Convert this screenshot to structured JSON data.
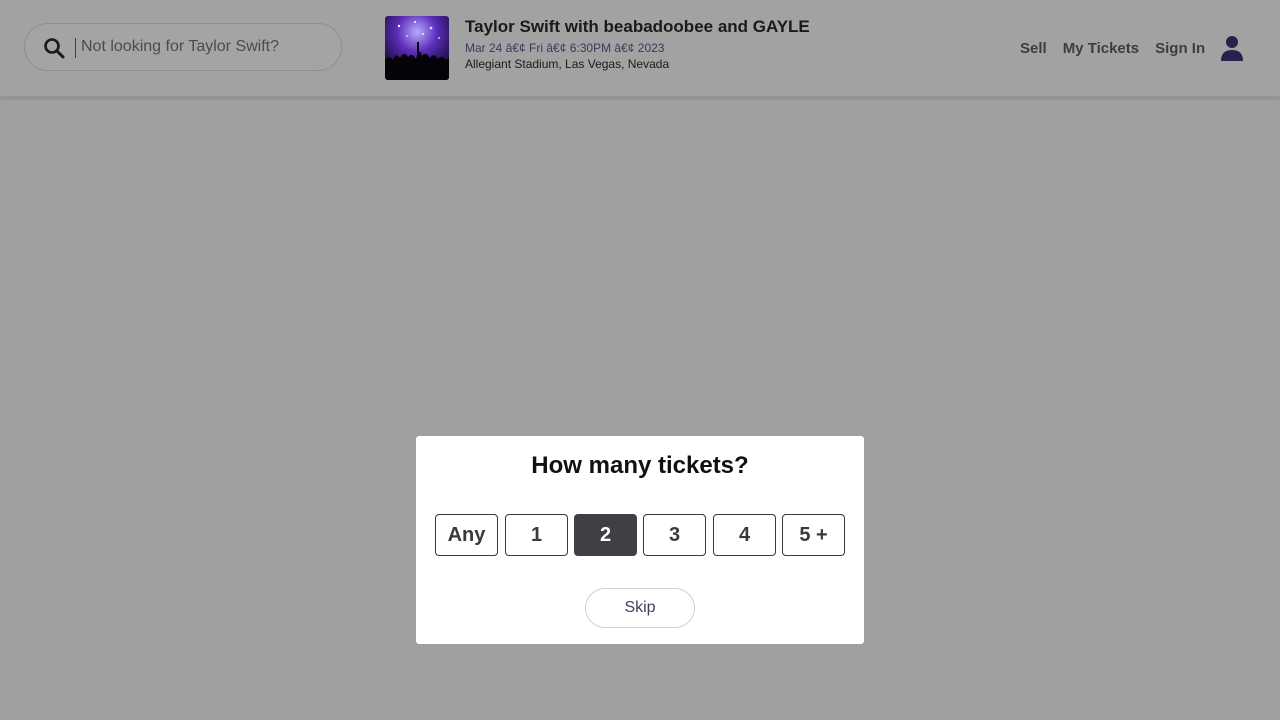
{
  "search": {
    "placeholder": "Not looking for Taylor Swift?",
    "icon": "search-icon"
  },
  "event": {
    "title": "Taylor Swift with beabadoobee and GAYLE",
    "date": "Mar 24 â€¢ Fri â€¢ 6:30PM â€¢ 2023",
    "venue": "Allegiant Stadium, Las Vegas, Nevada",
    "thumbnail_icon": "concert-image"
  },
  "nav": {
    "sell": "Sell",
    "my_tickets": "My Tickets",
    "sign_in": "Sign In",
    "avatar_icon": "user-icon"
  },
  "modal": {
    "title": "How many tickets?",
    "options": [
      "Any",
      "1",
      "2",
      "3",
      "4",
      "5 +"
    ],
    "selected": "2",
    "skip": "Skip"
  },
  "colors": {
    "overlay": "#a0a0a0",
    "selected_button": "#3e4043",
    "modal_bg": "#ffffff"
  }
}
